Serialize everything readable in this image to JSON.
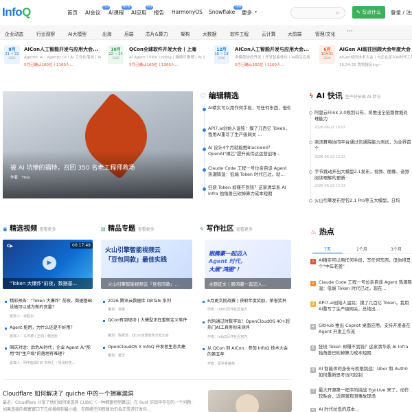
{
  "header": {
    "logo_main": "Info",
    "logo_q": "Q",
    "nav": [
      "首页",
      "AI会议",
      "AI课程",
      "AI应用",
      "报告",
      "HarmonyOS",
      "Snowflake",
      "更多"
    ],
    "badges": [
      "hot",
      "NEW",
      "hot",
      "new"
    ],
    "write_button": "写点什么",
    "login": "登录 / 注册"
  },
  "categories": [
    "企业动态",
    "行业观察",
    "AI大模型",
    "出海",
    "后端",
    "芯片&算力",
    "架构",
    "大数据",
    "软件工程",
    "云计算",
    "大前端",
    "管理/文化"
  ],
  "events": [
    {
      "month": "8月",
      "day": "21 ~ 22",
      "year": "2026",
      "title": "AICon人工智能开发与应用大会...",
      "sub": "Agentic AI丨Agentic UI丨AI 工业化落地丨AI工程化与智能体...",
      "hot": "5月已确认160位丨1160人..."
    },
    {
      "month": "10月",
      "day": "22 ~ 24",
      "year": "2026",
      "title": "QCon全球软件开发大会丨上海",
      "sub": "AI Agent丨Vibe Coding丨端侧可推理丨AI 全场景开放实时数据...",
      "hot": "5月已确认160位丨1360人..."
    },
    {
      "month": "12月",
      "day": "18 ~ 19",
      "year": "2026",
      "title": "AICon人工智能开发与应用大会...",
      "sub": "多模型协同开发丨开发智能体化丨AI原生应用丨Agent开发实战...",
      "hot": "5月已确认160位丨1160人..."
    },
    {
      "month": "6月",
      "day": "10月31",
      "year": "2026",
      "title": "AIGen AI既往回顾大会年度大会",
      "sub": "AIGen经历技术大会丨与正在定义AI时代工作与生活方式的...",
      "hot": "10.24-25 我将报名ing~"
    }
  ],
  "hero": {
    "title": "被 AI 坑惨的福特，召回 350 名老工程师救场",
    "author": "作者：Tina"
  },
  "editor_picks": {
    "title": "编辑精选",
    "items": [
      "AI精实可以用作何手段，写任何东西，但你得是个\"中年老爸\"",
      "API7.ai创始人温铭：摸了几百亿 Token，我用AI重写了生产级网关 ...",
      "AI 设计4个月就能推Blackwell？OpenAI\"裸芯\"提升英伟达运营战场...",
      "Claude Code 工程一号位亲自谈 Agent 热潮降温：低端 Token 时代已过，就...",
      "狂烧 Token 却赚不到钱？这家清华系 AI Infra 独角兽已砍掉算力成本短期"
    ]
  },
  "news": {
    "title": "AI 快讯",
    "sub": "生产好节省 AI 参与",
    "items": [
      {
        "text": "阿里云Flink 3.0规划公布，将推出全链路数据处理能力",
        "time": "2026-06-27 10:07"
      },
      {
        "text": "商汤算电协同平台通过信通院能力测试，为业界首个",
        "time": "2026-06-23 13:22"
      },
      {
        "text": "字节跳动开出大模型2.1发布，视频、图像、音频阅读理解的更新",
        "time": "2026-06-23 13:13"
      },
      {
        "text": "火山引擎发布豆包2.1 Pro等五大模型，日均",
        "time": ""
      }
    ]
  },
  "videos": {
    "title": "精选视频",
    "more": "查看更多",
    "thumb_caption": "\"Token 大爆炸\"前夜，数据基...",
    "duration": "00:17:49",
    "items": [
      {
        "text": "精彩预告：\"Token 大爆炸\" 前夜，数据基础设施可以成为新的变量？",
        "meta": "嘉宾人：卓胜石"
      },
      {
        "text": "Agent 能用，为什么还是不好用？",
        "meta": "嘉宾人：马可德丨王翊丨韩佳宏"
      },
      {
        "text": "国庆对话：后危AI时代，企业 Agent 从\"能用\"到\"生产级\"的落地有难理？",
        "meta": "嘉宾人：明丰能源CIO 刘传汇丨领讯科技..."
      }
    ]
  },
  "topics": {
    "title": "精品专题",
    "more": "查看更多",
    "thumb_line1": "火山引擎智能视频云",
    "thumb_line2": "「豆包同款」最佳实践",
    "thumb_caption": "火山引擎智能视频云「豆包同款」...",
    "items": [
      {
        "text": "2026 腾讯云数据库 DBTalk 系列",
        "meta": "策划：袁敏"
      },
      {
        "text": "QCon有到现场 | 大模型正在重新定义软件",
        "meta": "策划：陈秀芳，QCon全球软件开发大会"
      },
      {
        "text": "OpenCloudOS X InfoQ 开发者生态共建",
        "meta": "策划：夏芝"
      }
    ]
  },
  "community": {
    "title": "写作社区",
    "more": "查看更多",
    "thumb_line1": "跟腾豪一起迈入",
    "thumb_line2": "Agent 时代，",
    "thumb_line3": "大展\"鸿图\"！",
    "thumb_caption": "主题征文 | 跟鸿豪一起迈入...",
    "items": [
      {
        "text": "6月更文挑战赛 | 获取年度奖励，荣誉奖杯",
        "meta": "作者：InfoQ写作社区官方"
      },
      {
        "text": "代码通过时数字派！OpenCloudOS 40+超热门AI工具等你来测评",
        "meta": "作者：InfoQ写作社区官方"
      },
      {
        "text": "从 QCon 到 AICon：参加 InfoQ 技术大会的第五年",
        "meta": "作者：星孕青藤苗"
      }
    ]
  },
  "hot": {
    "title": "热点",
    "tabs": [
      "7天",
      "1个月",
      "3个月"
    ],
    "items": [
      "AI精实可以用作何手段，写任何东西，但你得是个\"中年老爸\"",
      "Claude Code 工程一号位亲自谈 Agent 热潮降温：低端 Token 时代已过，现在...",
      "API7.ai创始人温铭：摸了几百亿 Token，我用AI重写了生产级网关，总结出...",
      "GitHub 推出 Copilot 桌面应用，支持开发者在 Agent 开发工作流",
      "狂烧 Token 却赚不到钱？这家清华系 AI Infra 独角兽已砍掉算力成本短期",
      "AI 智能体的身份与权限挑战：Uber 和 Auth0 如何重新思考访问控制",
      "最大开源第一程序的挑战 EgoLive 来了，动作较贴合，近距离观测事故现场",
      "AI 时代拉低的成本..."
    ]
  },
  "bottom_article": {
    "title": "Cloudflare 如何解决了 quiche 中的一个拥塞漏洞",
    "summary": "最近，Cloudflare 分享了他们如何发现其 CUBIC（一种拥塞控制算法）在 Rust 实现中存在的一个问题：如果连接的拥塞窗口下已经塌缩到最小值，在网络空闲恢复后仍会正常进行发包..."
  },
  "colors": {
    "brand_blue": "#1b7ad6",
    "brand_green": "#32b35c",
    "accent_orange": "#e8502e"
  }
}
